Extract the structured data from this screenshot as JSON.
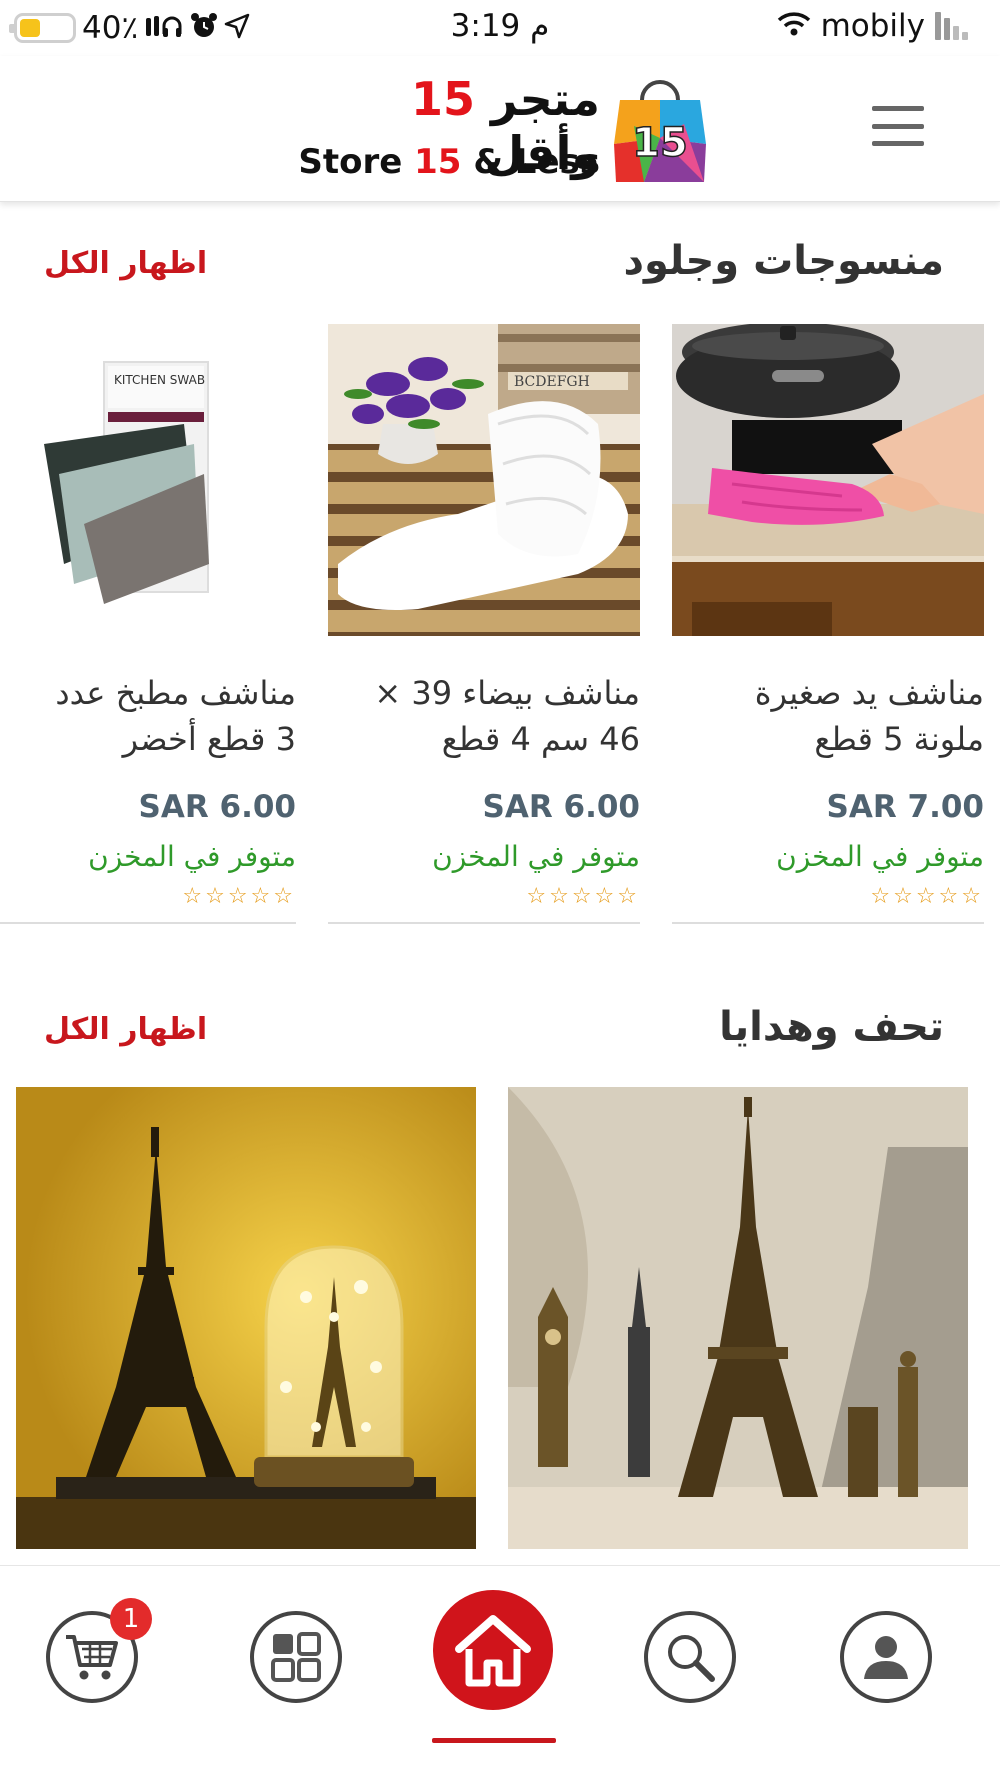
{
  "status_bar": {
    "battery_percent": "40٪",
    "time": "3:19 م",
    "carrier": "mobily"
  },
  "header": {
    "logo_ar_1": "متجر",
    "logo_ar_num": "15",
    "logo_ar_2": "وأقل",
    "logo_en_1": "Store",
    "logo_en_num": "15",
    "logo_en_2": "& Less",
    "logo_bag_num": "15"
  },
  "section_textiles": {
    "title": "منسوجات وجلود",
    "see_all": "اظهار الكل",
    "products": [
      {
        "name_line1": "مناشف يد صغيرة",
        "name_line2": "ملونة 5 قطع",
        "price": "SAR 7.00",
        "stock": "متوفر في المخزن",
        "stars": "☆☆☆☆☆"
      },
      {
        "name_line1": "مناشف بيضاء 39 ×",
        "name_line2": "46 سم 4 قطع",
        "price": "SAR 6.00",
        "stock": "متوفر في المخزن",
        "stars": "☆☆☆☆☆"
      },
      {
        "name_line1": "مناشف مطبخ عدد",
        "name_line2": "3 قطع أخضر",
        "price": "SAR 6.00",
        "stock": "متوفر في المخزن",
        "stars": "☆☆☆☆☆"
      }
    ]
  },
  "section_gifts": {
    "title": "تحف وهدايا",
    "see_all": "اظهار الكل",
    "swab_label": "KITCHEN SWAB"
  },
  "bottom_nav": {
    "cart_badge": "1"
  },
  "colors": {
    "accent": "#c8171d",
    "price": "#4f6270",
    "in_stock": "#2f9a2a",
    "stars": "#e59a17"
  }
}
